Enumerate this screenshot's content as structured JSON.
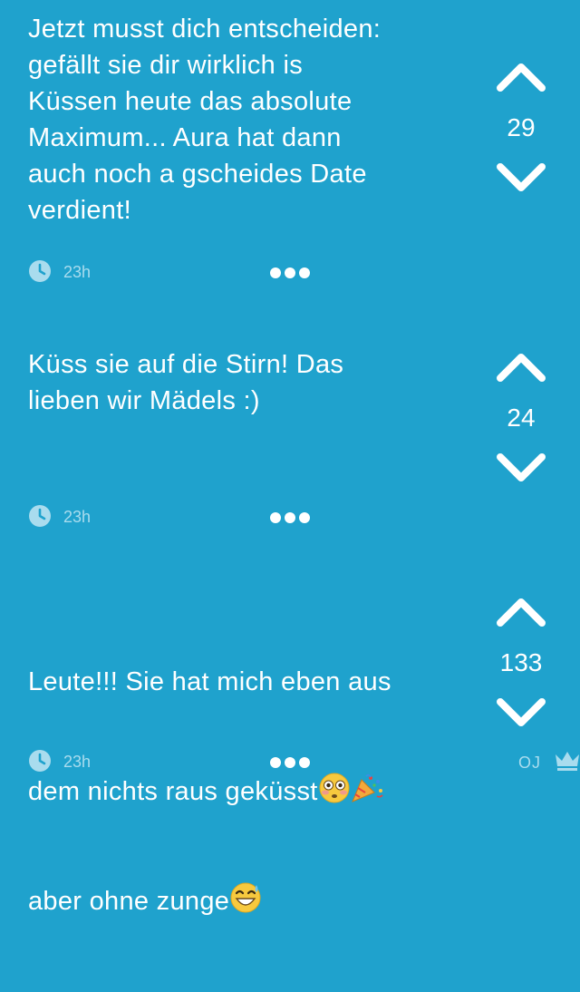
{
  "posts": [
    {
      "text": "Jetzt musst dich entscheiden:\ngefällt sie dir wirklich is\nKüssen heute das absolute\nMaximum... Aura hat dann\nauch noch a gscheides Date\nverdient!",
      "votes": "29",
      "time": "23h"
    },
    {
      "text": "Küss sie auf die Stirn! Das\nlieben wir Mädels :)",
      "votes": "24",
      "time": "23h"
    },
    {
      "text_line1": "Leute!!! Sie hat mich eben aus",
      "text_line2": "dem nichts raus geküsst",
      "text_line3": "aber ohne zunge",
      "votes": "133",
      "time": "23h",
      "op_label": "OJ"
    }
  ],
  "icons": {
    "upvote": "chevron-up-icon",
    "downvote": "chevron-down-icon",
    "clock": "clock-icon",
    "more": "more-dots-icon",
    "crown": "crown-icon",
    "flushed_emoji": "flushed-face-emoji",
    "party_emoji": "party-popper-emoji",
    "sweat_smile_emoji": "grinning-sweat-emoji"
  },
  "colors": {
    "background": "#1fa2cd",
    "text": "#ffffff",
    "meta_text": "#a9dcee"
  }
}
